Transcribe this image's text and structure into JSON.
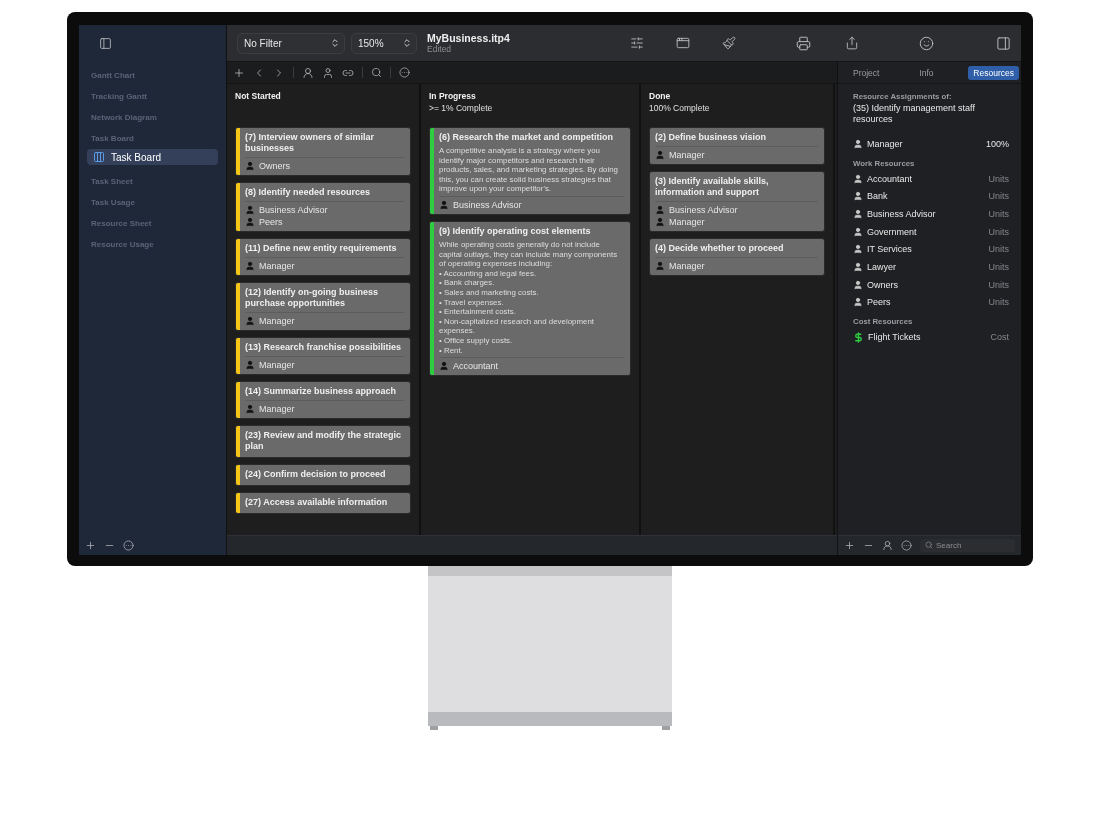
{
  "sidebar": {
    "items": [
      {
        "label": "Gantt Chart",
        "selected": false
      },
      {
        "label": "Tracking Gantt",
        "selected": false
      },
      {
        "label": "Network Diagram",
        "selected": false
      },
      {
        "label": "Task Board",
        "selected": false,
        "children": [
          {
            "label": "Task Board",
            "selected": true
          }
        ]
      },
      {
        "label": "Task Sheet",
        "selected": false
      },
      {
        "label": "Task Usage",
        "selected": false
      },
      {
        "label": "Resource Sheet",
        "selected": false
      },
      {
        "label": "Resource Usage",
        "selected": false
      }
    ]
  },
  "toolbar": {
    "filter": "No Filter",
    "zoom": "150%",
    "document": {
      "title": "MyBusiness.itp4",
      "status": "Edited"
    }
  },
  "board": {
    "columns": [
      {
        "title": "Not Started",
        "color": "#f5c518",
        "cards": [
          {
            "title": "(7) Interview owners of similar businesses",
            "resources": [
              "Owners"
            ]
          },
          {
            "title": "(8) Identify needed resources",
            "resources": [
              "Business Advisor",
              "Peers"
            ]
          },
          {
            "title": "(11) Define new entity requirements",
            "resources": [
              "Manager"
            ]
          },
          {
            "title": "(12) Identify on-going business purchase opportunities",
            "resources": [
              "Manager"
            ]
          },
          {
            "title": "(13) Research franchise possibilities",
            "resources": [
              "Manager"
            ]
          },
          {
            "title": "(14) Summarize business approach",
            "resources": [
              "Manager"
            ]
          },
          {
            "title": "(23) Review and modify the strategic plan"
          },
          {
            "title": "(24) Confirm decision to proceed"
          },
          {
            "title": "(27) Access available information"
          }
        ]
      },
      {
        "title": "In Progress",
        "subtitle": ">= 1% Complete",
        "color": "#2ecc40",
        "cards": [
          {
            "title": "(6) Research the market and competition",
            "description": "A competitive analysis is a strategy where you identify major competitors and research their products, sales, and marketing strategies. By doing this, you can create solid business strategies that improve upon your competitor's.",
            "resources": [
              "Business Advisor"
            ]
          },
          {
            "title": "(9) Identify operating cost elements",
            "description": "While operating costs generally do not include capital outlays, they can include many components of operating expenses including:\n• Accounting and legal fees.\n• Bank charges.\n• Sales and marketing costs.\n• Travel expenses.\n• Entertainment costs.\n• Non-capitalized research and development expenses.\n• Office supply costs.\n• Rent.",
            "resources": [
              "Accountant"
            ]
          }
        ]
      },
      {
        "title": "Done",
        "subtitle": "100% Complete",
        "cards": [
          {
            "title": "(2) Define business vision",
            "resources": [
              "Manager"
            ]
          },
          {
            "title": "(3) Identify available skills, information and support",
            "resources": [
              "Business Advisor",
              "Manager"
            ]
          },
          {
            "title": "(4) Decide whether to proceed",
            "resources": [
              "Manager"
            ]
          }
        ]
      }
    ]
  },
  "inspector": {
    "tabs": [
      {
        "label": "Project",
        "selected": false
      },
      {
        "label": "Info",
        "selected": false
      },
      {
        "label": "Resources",
        "selected": true
      }
    ],
    "heading": "Resource Assignments of:",
    "task": "(35) Identify management staff resources",
    "assignments": [
      {
        "name": "Manager",
        "value": "100%"
      }
    ],
    "sections": [
      {
        "title": "Work Resources",
        "items": [
          {
            "kind": "person",
            "name": "Accountant",
            "unit": "Units"
          },
          {
            "kind": "person",
            "name": "Bank",
            "unit": "Units"
          },
          {
            "kind": "person",
            "name": "Business Advisor",
            "unit": "Units"
          },
          {
            "kind": "person",
            "name": "Government",
            "unit": "Units"
          },
          {
            "kind": "person",
            "name": "IT Services",
            "unit": "Units"
          },
          {
            "kind": "person",
            "name": "Lawyer",
            "unit": "Units"
          },
          {
            "kind": "person",
            "name": "Owners",
            "unit": "Units"
          },
          {
            "kind": "person",
            "name": "Peers",
            "unit": "Units"
          }
        ]
      },
      {
        "title": "Cost Resources",
        "items": [
          {
            "kind": "cost",
            "name": "Flight Tickets",
            "unit": "Cost"
          }
        ]
      }
    ],
    "search": {
      "placeholder": "Search"
    }
  }
}
